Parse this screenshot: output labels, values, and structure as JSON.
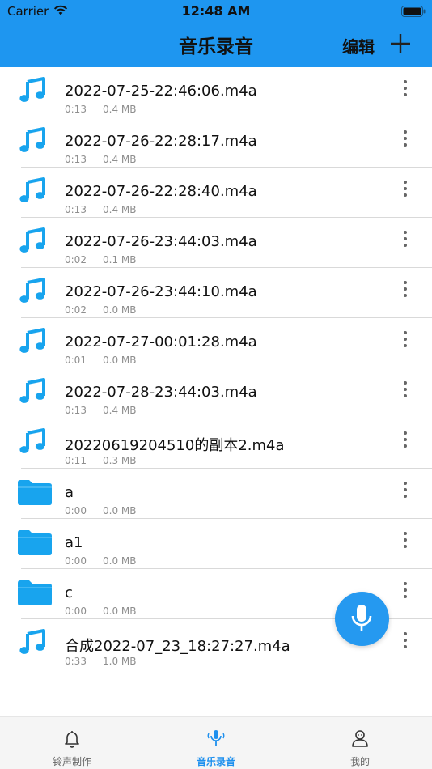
{
  "status_bar": {
    "carrier": "Carrier",
    "time": "12:48 AM"
  },
  "nav": {
    "title": "音乐录音",
    "edit_label": "编辑"
  },
  "colors": {
    "accent": "#1e96f0",
    "file_icon": "#18a4ee",
    "fab": "#2599f0"
  },
  "items": [
    {
      "type": "audio",
      "icon": "music-note-icon",
      "name": "2022-07-25-22:46:06.m4a",
      "duration": "0:13",
      "size": "0.4 MB"
    },
    {
      "type": "audio",
      "icon": "music-note-icon",
      "name": "2022-07-26-22:28:17.m4a",
      "duration": "0:13",
      "size": "0.4 MB"
    },
    {
      "type": "audio",
      "icon": "music-note-icon",
      "name": "2022-07-26-22:28:40.m4a",
      "duration": "0:13",
      "size": "0.4 MB"
    },
    {
      "type": "audio",
      "icon": "music-note-icon",
      "name": "2022-07-26-23:44:03.m4a",
      "duration": "0:02",
      "size": "0.1 MB"
    },
    {
      "type": "audio",
      "icon": "music-note-icon",
      "name": "2022-07-26-23:44:10.m4a",
      "duration": "0:02",
      "size": "0.0 MB"
    },
    {
      "type": "audio",
      "icon": "music-note-icon",
      "name": "2022-07-27-00:01:28.m4a",
      "duration": "0:01",
      "size": "0.0 MB"
    },
    {
      "type": "audio",
      "icon": "music-note-icon",
      "name": "2022-07-28-23:44:03.m4a",
      "duration": "0:13",
      "size": "0.4 MB"
    },
    {
      "type": "audio",
      "icon": "music-note-icon",
      "name": "20220619204510的副本2.m4a",
      "duration": "0:11",
      "size": "0.3 MB"
    },
    {
      "type": "folder",
      "icon": "folder-icon",
      "name": "a",
      "duration": "0:00",
      "size": "0.0 MB"
    },
    {
      "type": "folder",
      "icon": "folder-icon",
      "name": "a1",
      "duration": "0:00",
      "size": "0.0 MB"
    },
    {
      "type": "folder",
      "icon": "folder-icon",
      "name": "c",
      "duration": "0:00",
      "size": "0.0 MB"
    },
    {
      "type": "audio",
      "icon": "music-note-icon",
      "name": "合成2022-07_23_18:27:27.m4a",
      "duration": "0:33",
      "size": "1.0 MB"
    }
  ],
  "tabs": [
    {
      "label": "铃声制作",
      "icon": "bell-icon",
      "active": false
    },
    {
      "label": "音乐录音",
      "icon": "microphone-icon",
      "active": true
    },
    {
      "label": "我的",
      "icon": "profile-icon",
      "active": false
    }
  ]
}
